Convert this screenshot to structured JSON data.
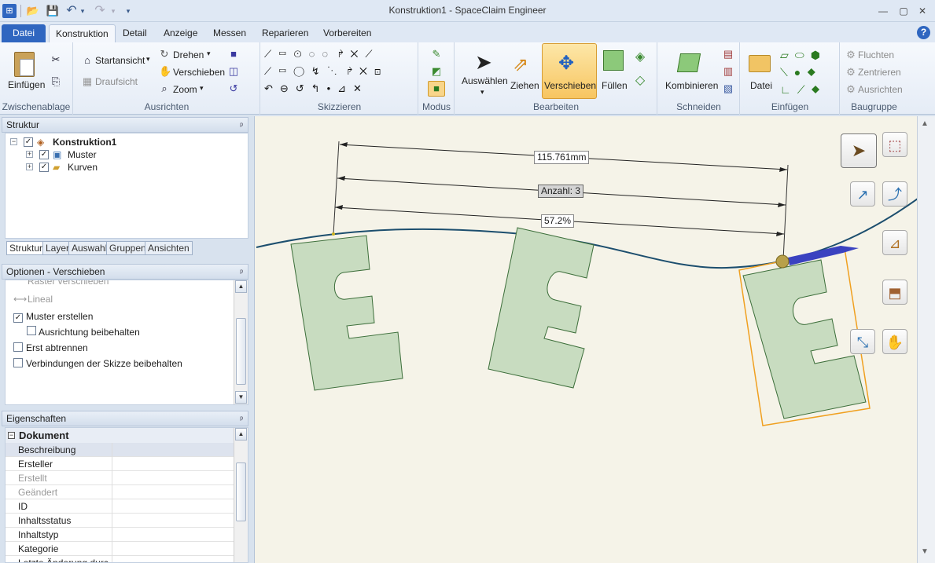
{
  "window": {
    "title": "Konstruktion1 - SpaceClaim Engineer",
    "minimize": "—",
    "restore": "▢",
    "close": "✕"
  },
  "quick_access": {
    "logo": "⊞",
    "open": "📂",
    "save": "💾",
    "undo": "↶",
    "undo_menu": "▾",
    "redo": "↷",
    "redo_menu": "▾",
    "customize": "▾"
  },
  "tabs": [
    "Datei",
    "Konstruktion",
    "Detail",
    "Anzeige",
    "Messen",
    "Reparieren",
    "Vorbereiten"
  ],
  "help_label": "?",
  "ribbon": {
    "zwischenablage": {
      "label": "Zwischenablage",
      "paste": "Einfügen"
    },
    "ausrichten": {
      "label": "Ausrichten",
      "startansicht": "Startansicht",
      "draufsicht": "Draufsicht",
      "drehen": "Drehen",
      "verschieben": "Verschieben",
      "zoom": "Zoom"
    },
    "skizzieren": {
      "label": "Skizzieren"
    },
    "modus": {
      "label": "Modus"
    },
    "bearbeiten": {
      "label": "Bearbeiten",
      "auswaehlen": "Auswählen",
      "ziehen": "Ziehen",
      "verschieben": "Verschieben",
      "fuellen": "Füllen"
    },
    "schneiden": {
      "label": "Schneiden",
      "kombinieren": "Kombinieren"
    },
    "einfuegen": {
      "label": "Einfügen",
      "datei": "Datei"
    },
    "baugruppe": {
      "label": "Baugruppe",
      "fluchten": "Fluchten",
      "zentrieren": "Zentrieren",
      "ausrichten": "Ausrichten"
    }
  },
  "struktur": {
    "title": "Struktur",
    "pin": "ᵖ",
    "root": "Konstruktion1",
    "children": [
      "Muster",
      "Kurven"
    ],
    "subtabs": [
      "Struktur",
      "Layer",
      "Auswahl",
      "Gruppen",
      "Ansichten"
    ]
  },
  "optionen": {
    "title": "Optionen - Verschieben",
    "pin": "ᵖ",
    "cut_item": "Raster verschieben",
    "items": [
      {
        "label": "Lineal",
        "checked": false,
        "disabled": true
      },
      {
        "label": "Muster erstellen",
        "checked": true
      },
      {
        "label": "Ausrichtung beibehalten",
        "checked": false,
        "indent": true
      },
      {
        "label": "Erst abtrennen",
        "checked": false
      },
      {
        "label": "Verbindungen der Skizze beibehalten",
        "checked": false
      }
    ]
  },
  "eigenschaften": {
    "title": "Eigenschaften",
    "pin": "ᵖ",
    "section": "Dokument",
    "rows": [
      "Beschreibung",
      "Ersteller",
      "Erstellt",
      "Geändert",
      "ID",
      "Inhaltsstatus",
      "Inhaltstyp",
      "Kategorie",
      "Letzte Änderung durc"
    ]
  },
  "canvas": {
    "dim_length": "115.761mm",
    "dim_count": "Anzahl: 3",
    "dim_percent": "57.2%"
  }
}
